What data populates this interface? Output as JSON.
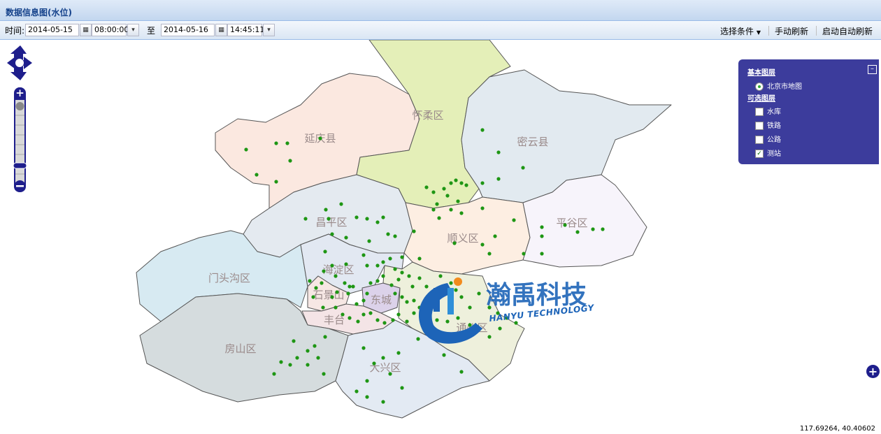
{
  "window": {
    "title": "数据信息图(水位)"
  },
  "toolbar": {
    "time_label": "时间:",
    "start_date": "2014-05-15",
    "start_time": "08:00:00",
    "to_label": "至",
    "end_date": "2014-05-16",
    "end_time": "14:45:11",
    "select_conditions": "选择条件",
    "manual_refresh": "手动刷新",
    "auto_refresh": "启动自动刷新"
  },
  "map": {
    "districts": [
      {
        "name": "延庆县",
        "color": "#fbe8e0"
      },
      {
        "name": "怀柔区",
        "color": "#e4efb8"
      },
      {
        "name": "密云县",
        "color": "#e2eaf0"
      },
      {
        "name": "昌平区",
        "color": "#e4eaf0"
      },
      {
        "name": "顺义区",
        "color": "#fdeee2"
      },
      {
        "name": "平谷区",
        "color": "#f7f4fb"
      },
      {
        "name": "门头沟区",
        "color": "#d7eaf2"
      },
      {
        "name": "海淀区",
        "color": "#e2e8f2"
      },
      {
        "name": "石景山",
        "color": "#f6e7e4"
      },
      {
        "name": "东城",
        "color": "#dcd2ea"
      },
      {
        "name": "丰台",
        "color": "#f4e4e6"
      },
      {
        "name": "通州区",
        "color": "#eef0dc"
      },
      {
        "name": "房山区",
        "color": "#d5dcde"
      },
      {
        "name": "大兴区",
        "color": "#e3eaf3"
      }
    ],
    "station_color": "#1e9614",
    "watermark": {
      "name": "瀚禹科技",
      "english": "HANYU TECHNOLOGY"
    },
    "coordinates": "117.69264, 40.40602"
  },
  "layer_switcher": {
    "base_title": "基本图层",
    "base_layers": [
      {
        "label": "北京市地图",
        "selected": true
      }
    ],
    "overlay_title": "可选图层",
    "overlays": [
      {
        "label": "水库",
        "checked": false
      },
      {
        "label": "铁路",
        "checked": false
      },
      {
        "label": "公路",
        "checked": false
      },
      {
        "label": "测站",
        "checked": true
      }
    ]
  }
}
